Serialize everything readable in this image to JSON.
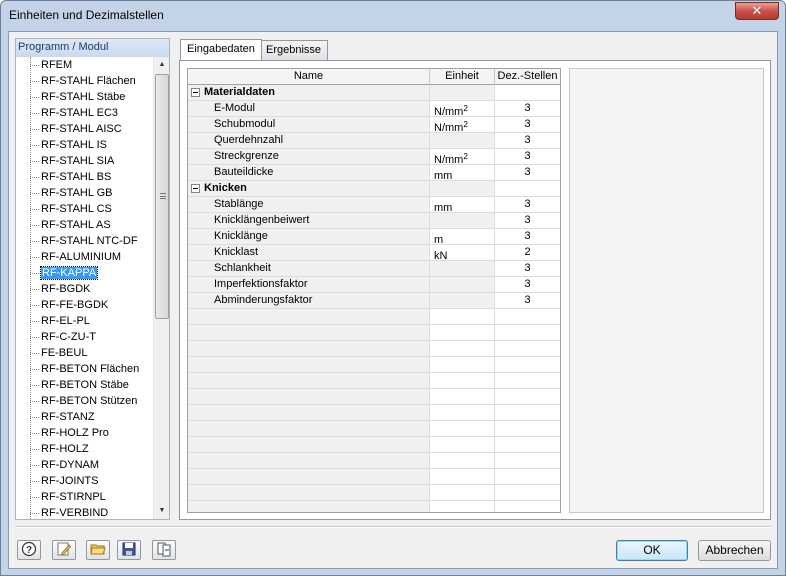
{
  "window": {
    "title": "Einheiten und Dezimalstellen",
    "close_symbol": "✕"
  },
  "left_panel": {
    "header": "Programm / Modul",
    "items": [
      "RFEM",
      "RF-STAHL Flächen",
      "RF-STAHL Stäbe",
      "RF-STAHL EC3",
      "RF-STAHL AISC",
      "RF-STAHL IS",
      "RF-STAHL SIA",
      "RF-STAHL BS",
      "RF-STAHL GB",
      "RF-STAHL CS",
      "RF-STAHL AS",
      "RF-STAHL NTC-DF",
      "RF-ALUMINIUM",
      "RF-KAPPA",
      "RF-BGDK",
      "RF-FE-BGDK",
      "RF-EL-PL",
      "RF-C-ZU-T",
      "FE-BEUL",
      "RF-BETON Flächen",
      "RF-BETON Stäbe",
      "RF-BETON Stützen",
      "RF-STANZ",
      "RF-HOLZ Pro",
      "RF-HOLZ",
      "RF-DYNAM",
      "RF-JOINTS",
      "RF-STIRNPL",
      "RF-VERBIND"
    ],
    "selected": "RF-KAPPA"
  },
  "tabs": [
    "Eingabedaten",
    "Ergebnisse"
  ],
  "grid": {
    "columns": [
      "Name",
      "Einheit",
      "Dez.-Stellen"
    ],
    "groups": [
      {
        "label": "Materialdaten",
        "rows": [
          {
            "name": "E-Modul",
            "unit": "N/mm",
            "unit_exp": "2",
            "dez": "3"
          },
          {
            "name": "Schubmodul",
            "unit": "N/mm",
            "unit_exp": "2",
            "dez": "3"
          },
          {
            "name": "Querdehnzahl",
            "unit": "",
            "unit_exp": "",
            "dez": "3"
          },
          {
            "name": "Streckgrenze",
            "unit": "N/mm",
            "unit_exp": "2",
            "dez": "3"
          },
          {
            "name": "Bauteildicke",
            "unit": "mm",
            "unit_exp": "",
            "dez": "3"
          }
        ]
      },
      {
        "label": "Knicken",
        "rows": [
          {
            "name": "Stablänge",
            "unit": "mm",
            "unit_exp": "",
            "dez": "3"
          },
          {
            "name": "Knicklängenbeiwert",
            "unit": "",
            "unit_exp": "",
            "dez": "3"
          },
          {
            "name": "Knicklänge",
            "unit": "m",
            "unit_exp": "",
            "dez": "3"
          },
          {
            "name": "Knicklast",
            "unit": "kN",
            "unit_exp": "",
            "dez": "2"
          },
          {
            "name": "Schlankheit",
            "unit": "",
            "unit_exp": "",
            "dez": "3"
          },
          {
            "name": "Imperfektionsfaktor",
            "unit": "",
            "unit_exp": "",
            "dez": "3"
          },
          {
            "name": "Abminderungsfaktor",
            "unit": "",
            "unit_exp": "",
            "dez": "3"
          }
        ]
      }
    ]
  },
  "buttons": {
    "ok": "OK",
    "cancel": "Abbrechen"
  },
  "icons": [
    "help-icon",
    "edit-icon",
    "open-folder-icon",
    "save-icon",
    "import-export-icon"
  ]
}
